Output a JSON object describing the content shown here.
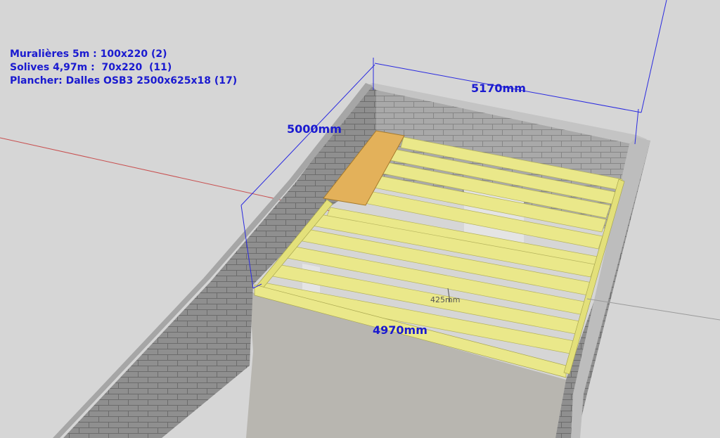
{
  "legend": {
    "line1": "Muralières 5m : 100x220 (2)",
    "line2": "Solives 4,97m :  70x220  (11)",
    "line3": "Plancher: Dalles OSB3 2500x625x18 (17)"
  },
  "dimensions": {
    "width_top": "5170mm",
    "depth_left": "5000mm",
    "width_front": "4970mm",
    "spacing": "425mm"
  },
  "colors": {
    "background": "#d6d6d6",
    "wall_brick": "#8e8e8e",
    "wall_top": "#b5b5b5",
    "joist": "#eae88a",
    "osb_panel": "#e3b15a",
    "floor": "#b8b6b0",
    "dimension": "#1a1ad0",
    "axis_red": "#c85050"
  }
}
